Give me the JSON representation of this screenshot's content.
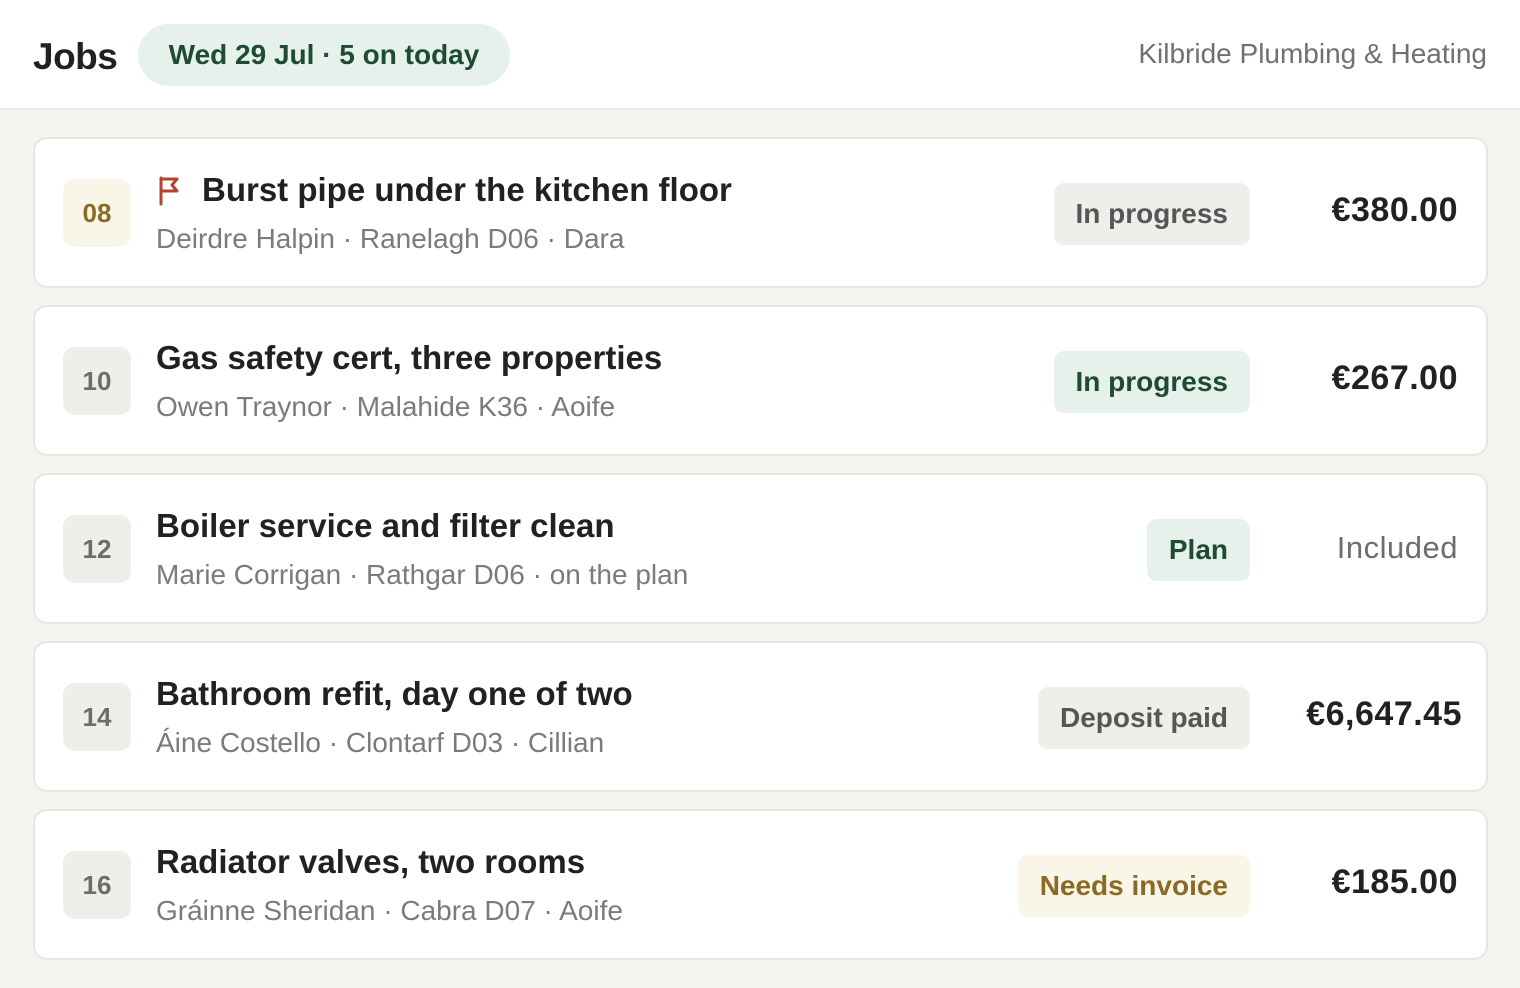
{
  "header": {
    "title": "Jobs",
    "date_pill": "Wed 29 Jul · 5 on today",
    "company": "Kilbride Plumbing & Heating"
  },
  "jobs": [
    {
      "time": "08",
      "flagged": true,
      "title": "Burst pipe under the kitchen floor",
      "meta": "Deirdre Halpin · Ranelagh D06 · Dara",
      "status": "In progress",
      "amount": "€380.00"
    },
    {
      "time": "10",
      "flagged": false,
      "title": "Gas safety cert, three properties",
      "meta": "Owen Traynor · Malahide K36 · Aoife",
      "status": "In progress",
      "amount": "€267.00"
    },
    {
      "time": "12",
      "flagged": false,
      "title": "Boiler service and filter clean",
      "meta": "Marie Corrigan · Rathgar D06 · on the plan",
      "status": "Plan",
      "amount": "Included"
    },
    {
      "time": "14",
      "flagged": false,
      "title": "Bathroom refit, day one of two",
      "meta": "Áine Costello · Clontarf D03 · Cillian",
      "status": "Deposit paid",
      "amount": "€6,647.45"
    },
    {
      "time": "16",
      "flagged": false,
      "title": "Radiator valves, two rooms",
      "meta": "Gráinne Sheridan · Cabra D07 · Aoife",
      "status": "Needs invoice",
      "amount": "€185.00"
    }
  ],
  "icons": {
    "flag": "flag-icon"
  },
  "colors": {
    "accent_green": "#1f4a34",
    "accent_green_bg": "#e6f1ec",
    "warning_gold": "#8a6a26",
    "warning_gold_bg": "#faf6e7",
    "flag_red": "#b5442e"
  }
}
